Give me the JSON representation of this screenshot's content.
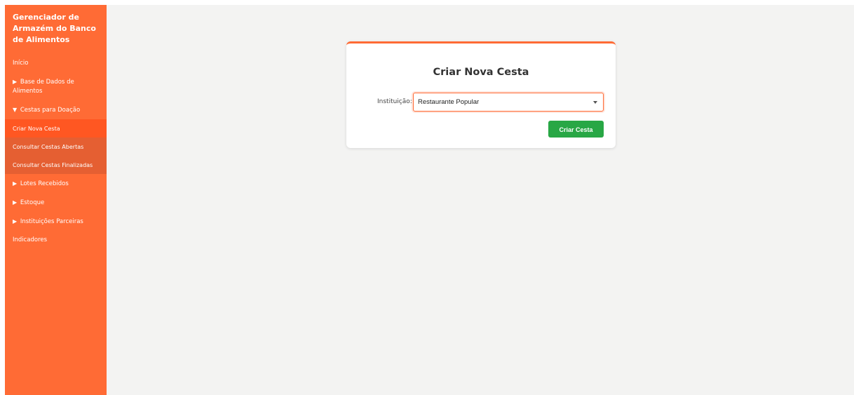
{
  "sidebar": {
    "brand": "Gerenciador de Armazém do Banco de Alimentos",
    "items": [
      {
        "label": "Início",
        "arrow": ""
      },
      {
        "label": "Base de Dados de Alimentos",
        "arrow": "▶"
      },
      {
        "label": "Cestas para Doação",
        "arrow": "▼"
      },
      {
        "label": "Lotes Recebidos",
        "arrow": "▶"
      },
      {
        "label": "Estoque",
        "arrow": "▶"
      },
      {
        "label": "Instituições Parceiras",
        "arrow": "▶"
      },
      {
        "label": "Indicadores",
        "arrow": ""
      }
    ],
    "subitems": [
      {
        "label": "Criar Nova Cesta"
      },
      {
        "label": "Consultar Cestas Abertas"
      },
      {
        "label": "Consultar Cestas Finalizadas"
      }
    ]
  },
  "form": {
    "title": "Criar Nova Cesta",
    "institution_label": "Instituição:",
    "institution_value": "Restaurante Popular",
    "submit_label": "Criar Cesta"
  },
  "colors": {
    "accent": "#ff6b35",
    "submenu_bg": "#e55f32",
    "active_submenu_bg": "#ff5722",
    "button": "#28a745",
    "main_bg": "#f3f3f2"
  }
}
